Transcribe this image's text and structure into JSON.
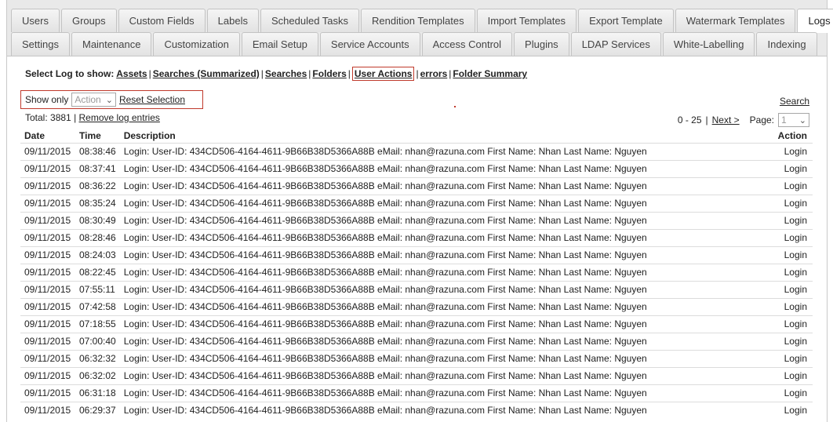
{
  "tabs_row1": [
    "Users",
    "Groups",
    "Custom Fields",
    "Labels",
    "Scheduled Tasks",
    "Rendition Templates",
    "Import Templates",
    "Export Template",
    "Watermark Templates",
    "Logs"
  ],
  "tabs_row2": [
    "Settings",
    "Maintenance",
    "Customization",
    "Email Setup",
    "Service Accounts",
    "Access Control",
    "Plugins",
    "LDAP Services",
    "White-Labelling",
    "Indexing"
  ],
  "active_tab": "Logs",
  "select_log": {
    "label": "Select Log to show:",
    "options": [
      "Assets",
      "Searches (Summarized)",
      "Searches",
      "Folders",
      "User Actions",
      "errors",
      "Folder Summary"
    ],
    "highlighted": "User Actions"
  },
  "filter": {
    "show_only_label": "Show only",
    "select_value": "Action",
    "reset_label": "Reset Selection"
  },
  "search_link": "Search",
  "total": {
    "label": "Total: 3881",
    "remove_label": "Remove log entries"
  },
  "pager": {
    "range": "0 - 25",
    "next_label": "Next >",
    "page_label": "Page:",
    "page_value": "1"
  },
  "table": {
    "headers": {
      "date": "Date",
      "time": "Time",
      "description": "Description",
      "action": "Action"
    },
    "rows": [
      {
        "date": "09/11/2015",
        "time": "08:38:46",
        "description": "Login: User-ID: 434CD506-4164-4611-9B66B38D5366A88B eMail: nhan@razuna.com First Name: Nhan Last Name: Nguyen",
        "action": "Login"
      },
      {
        "date": "09/11/2015",
        "time": "08:37:41",
        "description": "Login: User-ID: 434CD506-4164-4611-9B66B38D5366A88B eMail: nhan@razuna.com First Name: Nhan Last Name: Nguyen",
        "action": "Login"
      },
      {
        "date": "09/11/2015",
        "time": "08:36:22",
        "description": "Login: User-ID: 434CD506-4164-4611-9B66B38D5366A88B eMail: nhan@razuna.com First Name: Nhan Last Name: Nguyen",
        "action": "Login"
      },
      {
        "date": "09/11/2015",
        "time": "08:35:24",
        "description": "Login: User-ID: 434CD506-4164-4611-9B66B38D5366A88B eMail: nhan@razuna.com First Name: Nhan Last Name: Nguyen",
        "action": "Login"
      },
      {
        "date": "09/11/2015",
        "time": "08:30:49",
        "description": "Login: User-ID: 434CD506-4164-4611-9B66B38D5366A88B eMail: nhan@razuna.com First Name: Nhan Last Name: Nguyen",
        "action": "Login"
      },
      {
        "date": "09/11/2015",
        "time": "08:28:46",
        "description": "Login: User-ID: 434CD506-4164-4611-9B66B38D5366A88B eMail: nhan@razuna.com First Name: Nhan Last Name: Nguyen",
        "action": "Login"
      },
      {
        "date": "09/11/2015",
        "time": "08:24:03",
        "description": "Login: User-ID: 434CD506-4164-4611-9B66B38D5366A88B eMail: nhan@razuna.com First Name: Nhan Last Name: Nguyen",
        "action": "Login"
      },
      {
        "date": "09/11/2015",
        "time": "08:22:45",
        "description": "Login: User-ID: 434CD506-4164-4611-9B66B38D5366A88B eMail: nhan@razuna.com First Name: Nhan Last Name: Nguyen",
        "action": "Login"
      },
      {
        "date": "09/11/2015",
        "time": "07:55:11",
        "description": "Login: User-ID: 434CD506-4164-4611-9B66B38D5366A88B eMail: nhan@razuna.com First Name: Nhan Last Name: Nguyen",
        "action": "Login"
      },
      {
        "date": "09/11/2015",
        "time": "07:42:58",
        "description": "Login: User-ID: 434CD506-4164-4611-9B66B38D5366A88B eMail: nhan@razuna.com First Name: Nhan Last Name: Nguyen",
        "action": "Login"
      },
      {
        "date": "09/11/2015",
        "time": "07:18:55",
        "description": "Login: User-ID: 434CD506-4164-4611-9B66B38D5366A88B eMail: nhan@razuna.com First Name: Nhan Last Name: Nguyen",
        "action": "Login"
      },
      {
        "date": "09/11/2015",
        "time": "07:00:40",
        "description": "Login: User-ID: 434CD506-4164-4611-9B66B38D5366A88B eMail: nhan@razuna.com First Name: Nhan Last Name: Nguyen",
        "action": "Login"
      },
      {
        "date": "09/11/2015",
        "time": "06:32:32",
        "description": "Login: User-ID: 434CD506-4164-4611-9B66B38D5366A88B eMail: nhan@razuna.com First Name: Nhan Last Name: Nguyen",
        "action": "Login"
      },
      {
        "date": "09/11/2015",
        "time": "06:32:02",
        "description": "Login: User-ID: 434CD506-4164-4611-9B66B38D5366A88B eMail: nhan@razuna.com First Name: Nhan Last Name: Nguyen",
        "action": "Login"
      },
      {
        "date": "09/11/2015",
        "time": "06:31:18",
        "description": "Login: User-ID: 434CD506-4164-4611-9B66B38D5366A88B eMail: nhan@razuna.com First Name: Nhan Last Name: Nguyen",
        "action": "Login"
      },
      {
        "date": "09/11/2015",
        "time": "06:29:37",
        "description": "Login: User-ID: 434CD506-4164-4611-9B66B38D5366A88B eMail: nhan@razuna.com First Name: Nhan Last Name: Nguyen",
        "action": "Login"
      }
    ]
  },
  "colors": {
    "highlight_border": "#c0392b",
    "tab_bar": "#e9e9e9",
    "row_divider": "#dcdcdc"
  }
}
